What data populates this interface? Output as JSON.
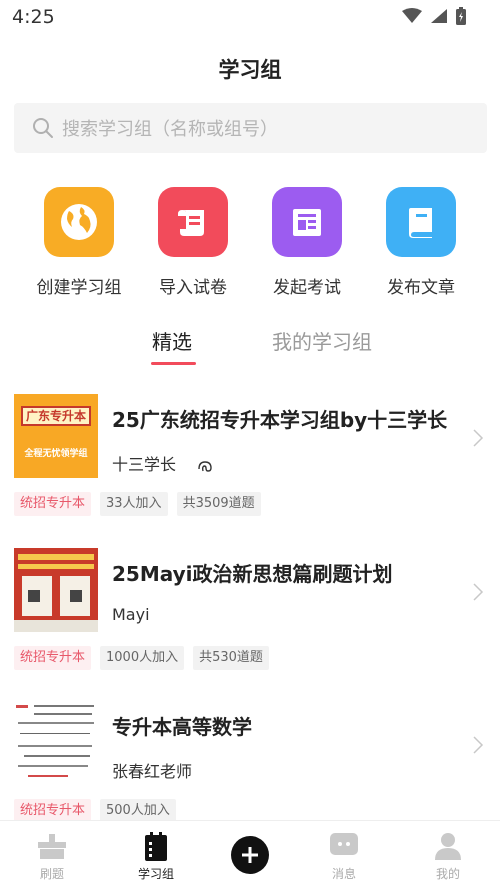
{
  "status_bar": {
    "time": "4:25"
  },
  "header": {
    "title": "学习组"
  },
  "search": {
    "placeholder": "搜索学习组（名称或组号）"
  },
  "actions": [
    {
      "label": "创建学习组",
      "icon": "globe-icon",
      "color": "#f8ac25"
    },
    {
      "label": "导入试卷",
      "icon": "scroll-icon",
      "color": "#f24b5b"
    },
    {
      "label": "发起考试",
      "icon": "newspaper-icon",
      "color": "#9c5cf0"
    },
    {
      "label": "发布文章",
      "icon": "book-icon",
      "color": "#3fb0f5"
    }
  ],
  "tabs": [
    {
      "label": "精选",
      "active": true
    },
    {
      "label": "我的学习组",
      "active": false
    }
  ],
  "accent_color": "#f24b5b",
  "groups": [
    {
      "title": "25广东统招专升本学习组by十三学长",
      "author": "十三学长",
      "thumb": {
        "banner": "广东专升本",
        "subtitle": "全程无忧领学组"
      },
      "tags": [
        "统招专升本",
        "33人加入",
        "共3509道题"
      ]
    },
    {
      "title": "25Mayi政治新思想篇刷题计划",
      "author": "Mayi",
      "tags": [
        "统招专升本",
        "1000人加入",
        "共530道题"
      ]
    },
    {
      "title": "专升本高等数学",
      "author": "张春红老师",
      "tags": [
        "统招专升本",
        "500人加入"
      ]
    }
  ],
  "bottom_nav": [
    {
      "label": "刷题",
      "icon": "practice-icon",
      "active": false
    },
    {
      "label": "学习组",
      "icon": "notebook-icon",
      "active": true
    },
    {
      "label": "",
      "icon": "add-icon",
      "active": false
    },
    {
      "label": "消息",
      "icon": "chat-icon",
      "active": false
    },
    {
      "label": "我的",
      "icon": "profile-icon",
      "active": false
    }
  ]
}
